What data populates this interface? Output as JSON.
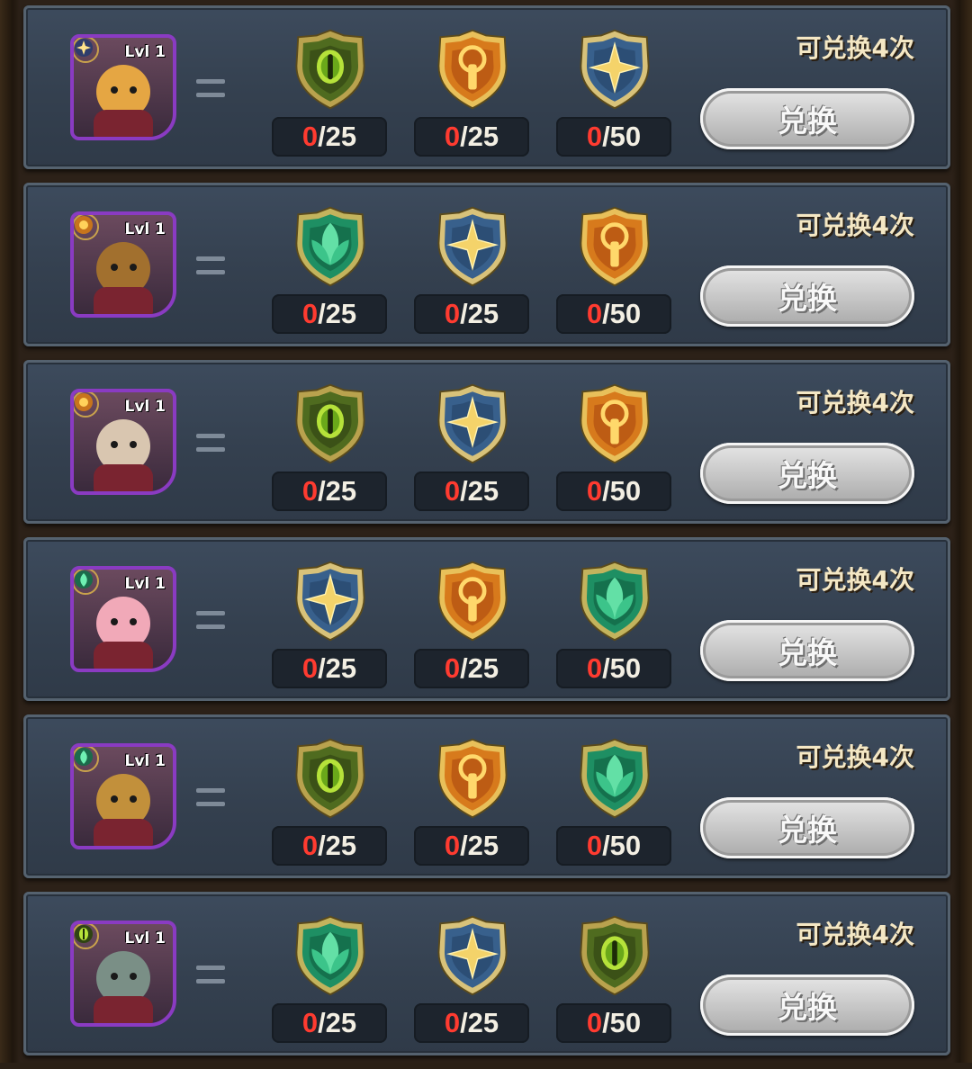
{
  "colors": {
    "count_have": "#ff3b30",
    "portrait_border": "#8a3bc2",
    "panel": "#3d4b5d"
  },
  "rows": [
    {
      "level": "Lvl 1",
      "faction": "star",
      "hero_hue": "#e5a643",
      "items": [
        {
          "icon": "eye-shield-icon",
          "have": "0",
          "need": "/25"
        },
        {
          "icon": "torch-shield-icon",
          "have": "0",
          "need": "/25"
        },
        {
          "icon": "star-shield-icon",
          "have": "0",
          "need": "/50"
        }
      ],
      "remain_text": "可兑换4次",
      "button_label": "兑换"
    },
    {
      "level": "Lvl 1",
      "faction": "sun",
      "hero_hue": "#a2702e",
      "items": [
        {
          "icon": "leaf-shield-icon",
          "have": "0",
          "need": "/25"
        },
        {
          "icon": "star-shield-icon",
          "have": "0",
          "need": "/25"
        },
        {
          "icon": "torch-shield-icon",
          "have": "0",
          "need": "/50"
        }
      ],
      "remain_text": "可兑换4次",
      "button_label": "兑换"
    },
    {
      "level": "Lvl 1",
      "faction": "sun",
      "hero_hue": "#d9c6b0",
      "items": [
        {
          "icon": "eye-shield-icon",
          "have": "0",
          "need": "/25"
        },
        {
          "icon": "star-shield-icon",
          "have": "0",
          "need": "/25"
        },
        {
          "icon": "torch-shield-icon",
          "have": "0",
          "need": "/50"
        }
      ],
      "remain_text": "可兑换4次",
      "button_label": "兑换"
    },
    {
      "level": "Lvl 1",
      "faction": "leaf",
      "hero_hue": "#f1a9b8",
      "items": [
        {
          "icon": "star-shield-icon",
          "have": "0",
          "need": "/25"
        },
        {
          "icon": "torch-shield-icon",
          "have": "0",
          "need": "/25"
        },
        {
          "icon": "leaf-shield-icon",
          "have": "0",
          "need": "/50"
        }
      ],
      "remain_text": "可兑换4次",
      "button_label": "兑换"
    },
    {
      "level": "Lvl 1",
      "faction": "leaf",
      "hero_hue": "#c2903b",
      "items": [
        {
          "icon": "eye-shield-icon",
          "have": "0",
          "need": "/25"
        },
        {
          "icon": "torch-shield-icon",
          "have": "0",
          "need": "/25"
        },
        {
          "icon": "leaf-shield-icon",
          "have": "0",
          "need": "/50"
        }
      ],
      "remain_text": "可兑换4次",
      "button_label": "兑换"
    },
    {
      "level": "Lvl 1",
      "faction": "eye",
      "hero_hue": "#7a8f86",
      "items": [
        {
          "icon": "leaf-shield-icon",
          "have": "0",
          "need": "/25"
        },
        {
          "icon": "star-shield-icon",
          "have": "0",
          "need": "/25"
        },
        {
          "icon": "eye-shield-icon",
          "have": "0",
          "need": "/50"
        }
      ],
      "remain_text": "可兑换4次",
      "button_label": "兑换"
    }
  ]
}
